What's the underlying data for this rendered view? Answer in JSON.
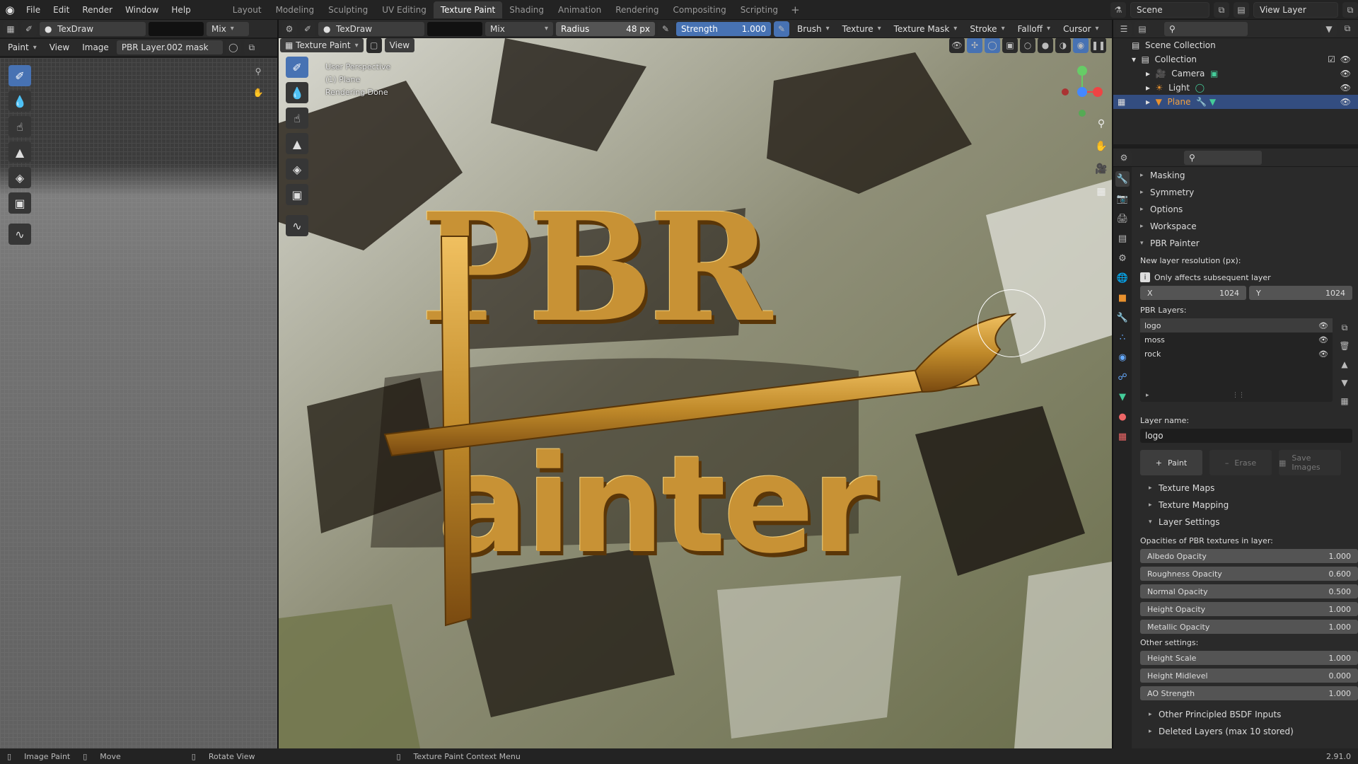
{
  "topbar": {
    "menu": [
      "File",
      "Edit",
      "Render",
      "Window",
      "Help"
    ],
    "tabs": [
      "Layout",
      "Modeling",
      "Sculpting",
      "UV Editing",
      "Texture Paint",
      "Shading",
      "Animation",
      "Rendering",
      "Compositing",
      "Scripting"
    ],
    "active_tab": "Texture Paint",
    "scene": "Scene",
    "view_layer": "View Layer"
  },
  "left_header": {
    "brush": "TexDraw",
    "blend": "Mix",
    "mode": "Paint",
    "view": "View",
    "image": "Image",
    "image_name": "PBR Layer.002 mask"
  },
  "vp_header": {
    "brush": "TexDraw",
    "blend": "Mix",
    "radius_label": "Radius",
    "radius_value": "48 px",
    "strength_label": "Strength",
    "strength_value": "1.000",
    "menus": [
      "Brush",
      "Texture",
      "Texture Mask",
      "Stroke",
      "Falloff",
      "Cursor"
    ],
    "mode": "Texture Paint",
    "view": "View"
  },
  "viewport": {
    "line1": "User Perspective",
    "line2": "(1) Plane",
    "line3": "Rendering Done",
    "logo_top": "PBR",
    "logo_bottom": "ainter"
  },
  "outliner": {
    "root": "Scene Collection",
    "collection": "Collection",
    "items": [
      "Camera",
      "Light",
      "Plane"
    ]
  },
  "props": {
    "panels": [
      "Masking",
      "Symmetry",
      "Options",
      "Workspace",
      "PBR Painter"
    ],
    "res_label": "New layer resolution (px):",
    "info": "Only affects subsequent layer",
    "x_label": "X",
    "x_value": "1024",
    "y_label": "Y",
    "y_value": "1024",
    "layers_label": "PBR Layers:",
    "layers": [
      "logo",
      "moss",
      "rock"
    ],
    "layer_name_label": "Layer name:",
    "layer_name": "logo",
    "paint": "Paint",
    "erase": "Erase",
    "save": "Save Images",
    "sub": [
      "Texture Maps",
      "Texture Mapping",
      "Layer Settings"
    ],
    "opac_label": "Opacities of PBR textures in layer:",
    "opacities": [
      {
        "name": "Albedo Opacity",
        "value": "1.000"
      },
      {
        "name": "Roughness Opacity",
        "value": "0.600"
      },
      {
        "name": "Normal Opacity",
        "value": "0.500"
      },
      {
        "name": "Height Opacity",
        "value": "1.000"
      },
      {
        "name": "Metallic Opacity",
        "value": "1.000"
      }
    ],
    "other_label": "Other settings:",
    "other": [
      {
        "name": "Height Scale",
        "value": "1.000"
      },
      {
        "name": "Height Midlevel",
        "value": "0.000"
      },
      {
        "name": "AO Strength",
        "value": "1.000"
      }
    ],
    "footer": [
      "Other Principled BSDF Inputs",
      "Deleted Layers (max 10 stored)"
    ]
  },
  "status": {
    "items": [
      "Image Paint",
      "Move",
      "Rotate View",
      "Texture Paint Context Menu"
    ],
    "version": "2.91.0"
  }
}
